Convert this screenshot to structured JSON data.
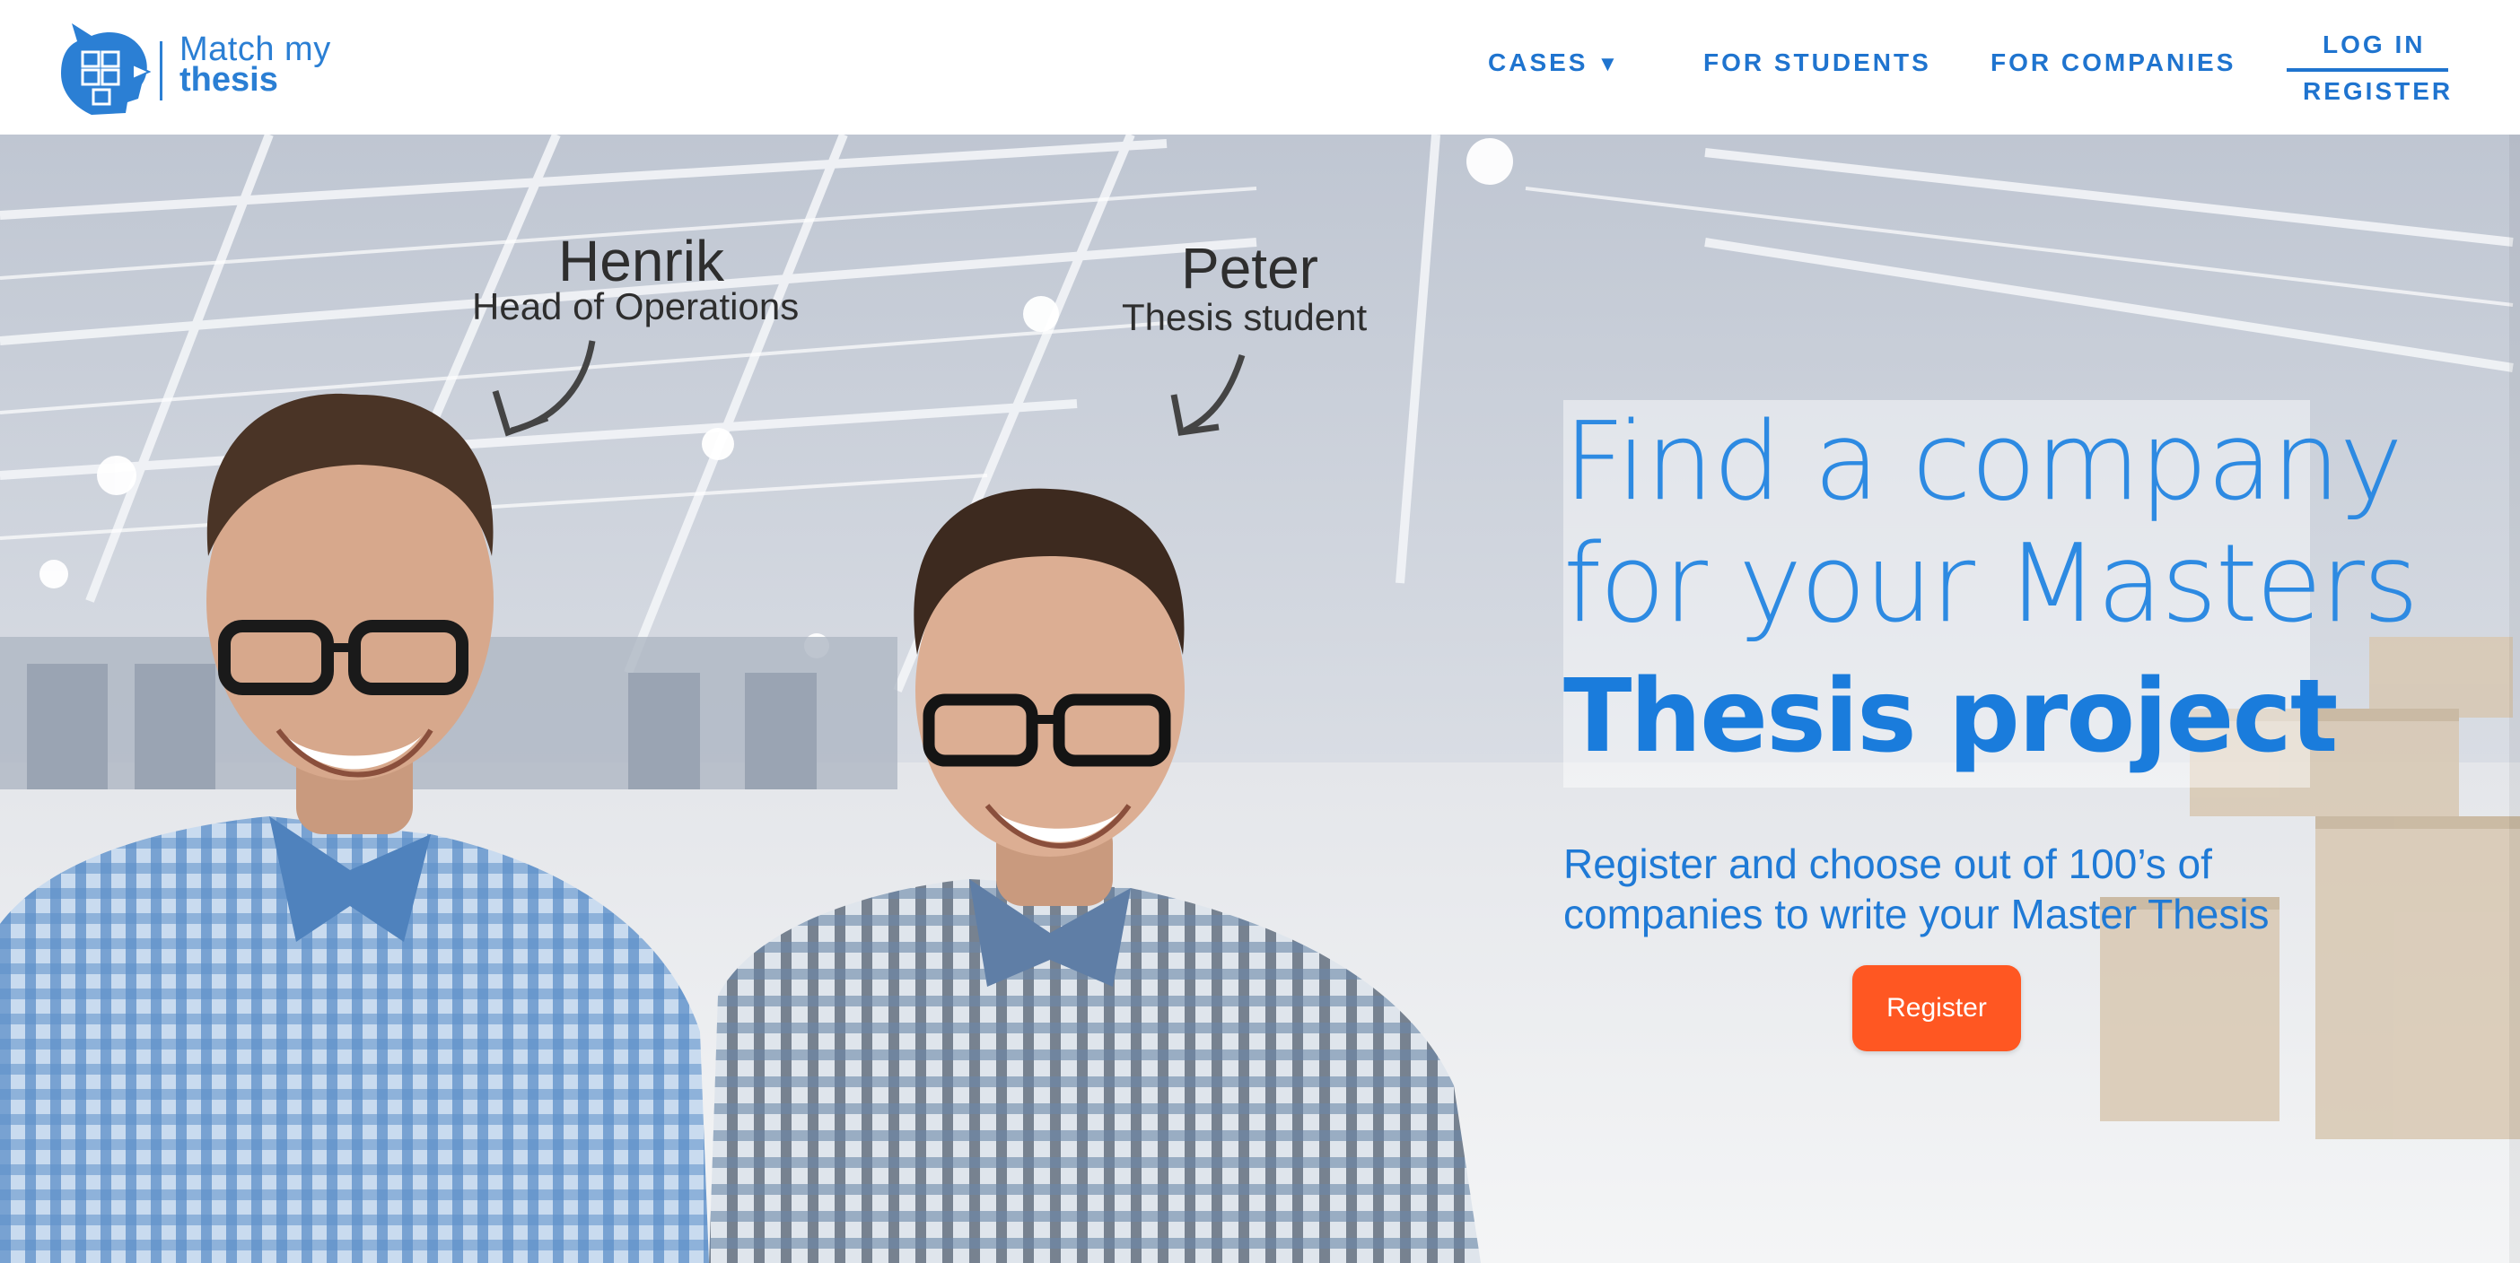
{
  "brand": {
    "line1": "Match my",
    "line2": "thesis",
    "color": "#2b7fd4"
  },
  "nav": {
    "cases": "CASES",
    "cases_caret": "▼",
    "students": "FOR STUDENTS",
    "companies": "FOR COMPANIES",
    "login": "LOG IN",
    "register": "REGISTER"
  },
  "hero": {
    "people": [
      {
        "name": "Henrik",
        "role": "Head of Operations"
      },
      {
        "name": "Peter",
        "role": "Thesis student"
      }
    ],
    "headline_1": "Find a company",
    "headline_2": "for your Masters",
    "headline_3": "Thesis project",
    "subtitle_1": "Register and choose out of 100’s of",
    "subtitle_2": "companies to write your Master Thesis",
    "cta": "Register"
  },
  "colors": {
    "accent": "#2d8ae2",
    "nav": "#1f74cf",
    "cta": "#ff5722"
  },
  "icons": [
    "logo-head-puzzle-icon",
    "caret-down-icon",
    "arrow-henrik-icon",
    "arrow-peter-icon"
  ]
}
